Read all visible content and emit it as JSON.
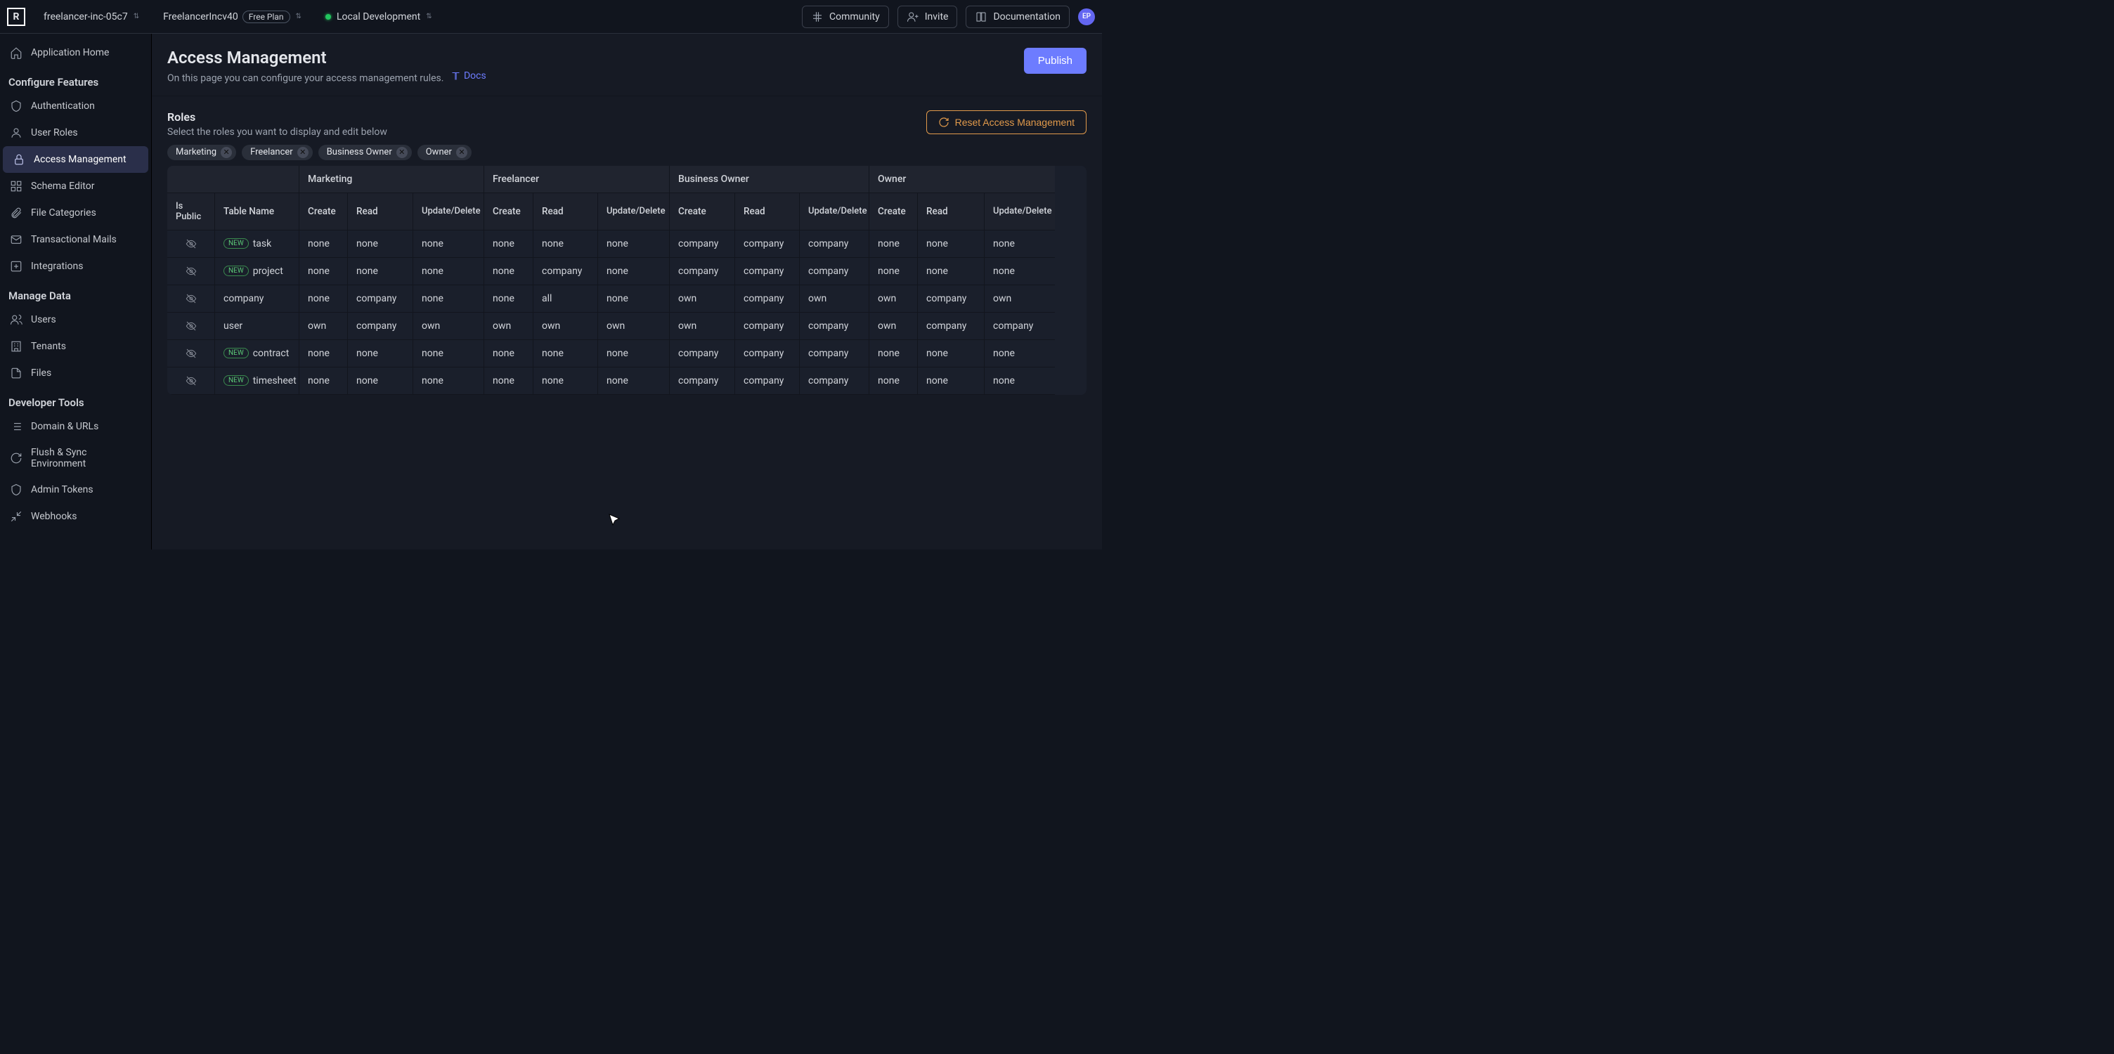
{
  "topbar": {
    "project": "freelancer-inc-05c7",
    "org": "FreelancerIncv40",
    "plan_label": "Free Plan",
    "env": "Local Development",
    "community": "Community",
    "invite": "Invite",
    "documentation": "Documentation",
    "avatar": "EP"
  },
  "sidebar": {
    "app_home": "Application Home",
    "group_configure": "Configure Features",
    "authentication": "Authentication",
    "user_roles": "User Roles",
    "access_management": "Access Management",
    "schema_editor": "Schema Editor",
    "file_categories": "File Categories",
    "transactional_mails": "Transactional Mails",
    "integrations": "Integrations",
    "group_manage": "Manage Data",
    "users": "Users",
    "tenants": "Tenants",
    "files": "Files",
    "group_dev": "Developer Tools",
    "domain_urls": "Domain & URLs",
    "flush_sync": "Flush & Sync Environment",
    "admin_tokens": "Admin Tokens",
    "webhooks": "Webhooks"
  },
  "page": {
    "title": "Access Management",
    "subtitle": "On this page you can configure your access management rules.",
    "docs": "Docs",
    "publish": "Publish",
    "roles_title": "Roles",
    "roles_hint": "Select the roles you want to display and edit below",
    "reset": "Reset Access Management"
  },
  "role_chips": [
    "Marketing",
    "Freelancer",
    "Business Owner",
    "Owner"
  ],
  "columns": {
    "is_public": "Is Public",
    "table_name": "Table Name",
    "create": "Create",
    "read": "Read",
    "update_delete": "Update/Delete"
  },
  "groups": [
    "Marketing",
    "Freelancer",
    "Business Owner",
    "Owner"
  ],
  "rows": [
    {
      "new": true,
      "name": "task",
      "cells": [
        "none",
        "none",
        "none",
        "none",
        "none",
        "none",
        "company",
        "company",
        "company",
        "none",
        "none",
        "none"
      ]
    },
    {
      "new": true,
      "name": "project",
      "cells": [
        "none",
        "none",
        "none",
        "none",
        "company",
        "none",
        "company",
        "company",
        "company",
        "none",
        "none",
        "none"
      ]
    },
    {
      "new": false,
      "name": "company",
      "cells": [
        "none",
        "company",
        "none",
        "none",
        "all",
        "none",
        "own",
        "company",
        "own",
        "own",
        "company",
        "own"
      ]
    },
    {
      "new": false,
      "name": "user",
      "cells": [
        "own",
        "company",
        "own",
        "own",
        "own",
        "own",
        "own",
        "company",
        "company",
        "own",
        "company",
        "company"
      ]
    },
    {
      "new": true,
      "name": "contract",
      "cells": [
        "none",
        "none",
        "none",
        "none",
        "none",
        "none",
        "company",
        "company",
        "company",
        "none",
        "none",
        "none"
      ]
    },
    {
      "new": true,
      "name": "timesheet",
      "cells": [
        "none",
        "none",
        "none",
        "none",
        "none",
        "none",
        "company",
        "company",
        "company",
        "none",
        "none",
        "none"
      ]
    }
  ],
  "new_label": "NEW"
}
